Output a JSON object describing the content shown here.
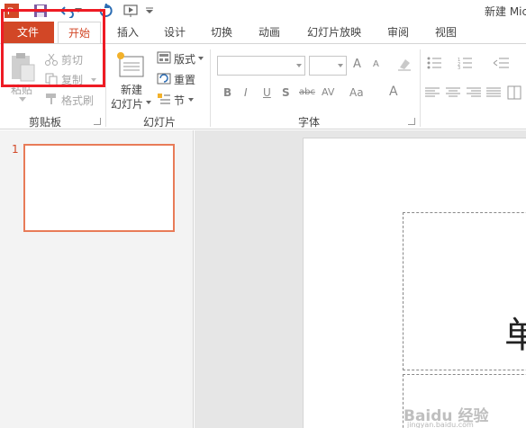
{
  "window": {
    "title": "新建 Mic"
  },
  "tabs": {
    "file": "文件",
    "home": "开始",
    "insert": "插入",
    "design": "设计",
    "transitions": "切换",
    "animations": "动画",
    "slideshow": "幻灯片放映",
    "review": "审阅",
    "view": "视图"
  },
  "clipboard": {
    "paste": "粘贴",
    "cut": "剪切",
    "copy": "复制",
    "format_painter": "格式刷",
    "group_label": "剪贴板"
  },
  "slides": {
    "new_slide_line1": "新建",
    "new_slide_line2": "幻灯片",
    "layout": "版式",
    "reset": "重置",
    "section": "节",
    "group_label": "幻灯片"
  },
  "font": {
    "bold": "B",
    "italic": "I",
    "underline": "U",
    "shadow": "S",
    "strikethrough": "abc",
    "spacing": "AV",
    "change_case": "Aa",
    "font_color": "A",
    "grow": "A",
    "shrink": "A",
    "group_label": "字体"
  },
  "thumbnails": {
    "slide_number": "1"
  },
  "slide": {
    "title_char": "单"
  },
  "watermark": {
    "brand": "Baidu 经验",
    "url": "jingyan.baidu.com"
  },
  "colors": {
    "accent": "#d24726",
    "highlight": "#ee1b24"
  }
}
